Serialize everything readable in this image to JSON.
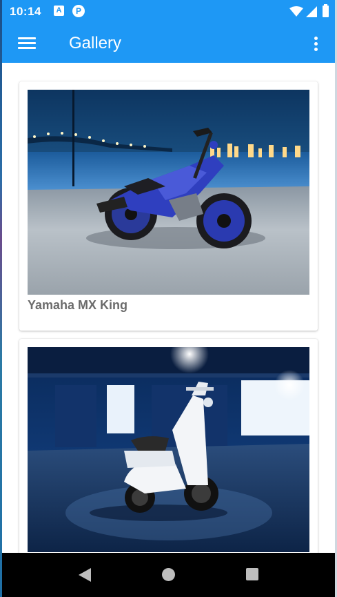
{
  "status_bar": {
    "time": "10:14",
    "icons": [
      "a-badge-icon",
      "p-badge-icon",
      "wifi-icon",
      "signal-icon",
      "battery-icon"
    ],
    "badge_a": "A",
    "badge_p": "P"
  },
  "app_bar": {
    "title": "Gallery",
    "menu_icon": "hamburger-menu-icon",
    "overflow_icon": "more-vert-icon",
    "color": "#1e98f5"
  },
  "gallery": {
    "items": [
      {
        "title": "Yamaha MX King",
        "image": "blue-sport-motorcycle-night-city-photo"
      },
      {
        "title": "",
        "image": "white-scooter-blue-garage-photo"
      }
    ]
  },
  "nav_bar": {
    "icons": [
      "back-icon",
      "home-icon",
      "recents-icon"
    ]
  }
}
